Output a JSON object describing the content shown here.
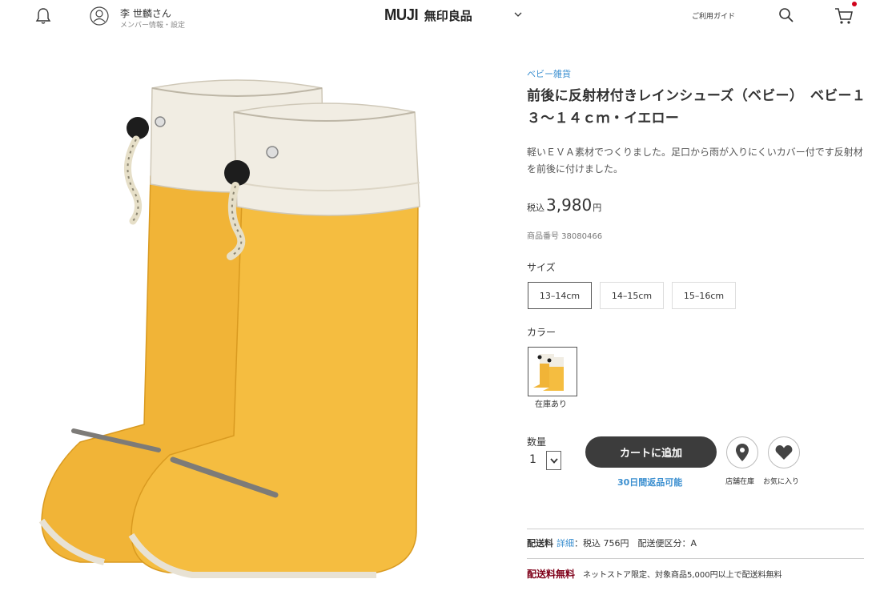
{
  "header": {
    "member_name": "李 世麟さん",
    "member_sub": "メンバー情報・設定",
    "logo_latin": "MUJI",
    "logo_jp": "無印良品",
    "guide": "ご利用ガイド",
    "accent": "#d0021b"
  },
  "product": {
    "category": "ベビー雑貨",
    "title": "前後に反射材付きレインシューズ（ベビー）　ベビー１３～１４ｃｍ・イエロー",
    "description": "軽いＥＶＡ素材でつくりました。足口から雨が入りにくいカバー付です反射材を前後に付けました。",
    "tax_label": "税込",
    "price": "3,980",
    "yen": "円",
    "item_number": "商品番号  38080466",
    "boot_color": "#f3b93c",
    "cuff_color": "#f1ede3"
  },
  "size": {
    "label": "サイズ",
    "options": [
      "13–14cm",
      "14–15cm",
      "15–16cm"
    ],
    "selected_index": 0
  },
  "color": {
    "label": "カラー",
    "stock": "在庫あり"
  },
  "quantity": {
    "label": "数量",
    "value": "1"
  },
  "actions": {
    "add_to_cart": "カートに追加",
    "return_note": "30日間返品可能",
    "store_stock": "店舗在庫",
    "favorite": "お気に入り"
  },
  "shipping": {
    "label": "配送料",
    "detail_link": "詳細",
    "fee_text": "：税込 756円　配送便区分：A",
    "free_label": "配送料無料",
    "free_text": "ネットストア限定、対象商品5,000円以上で配送料無料"
  }
}
